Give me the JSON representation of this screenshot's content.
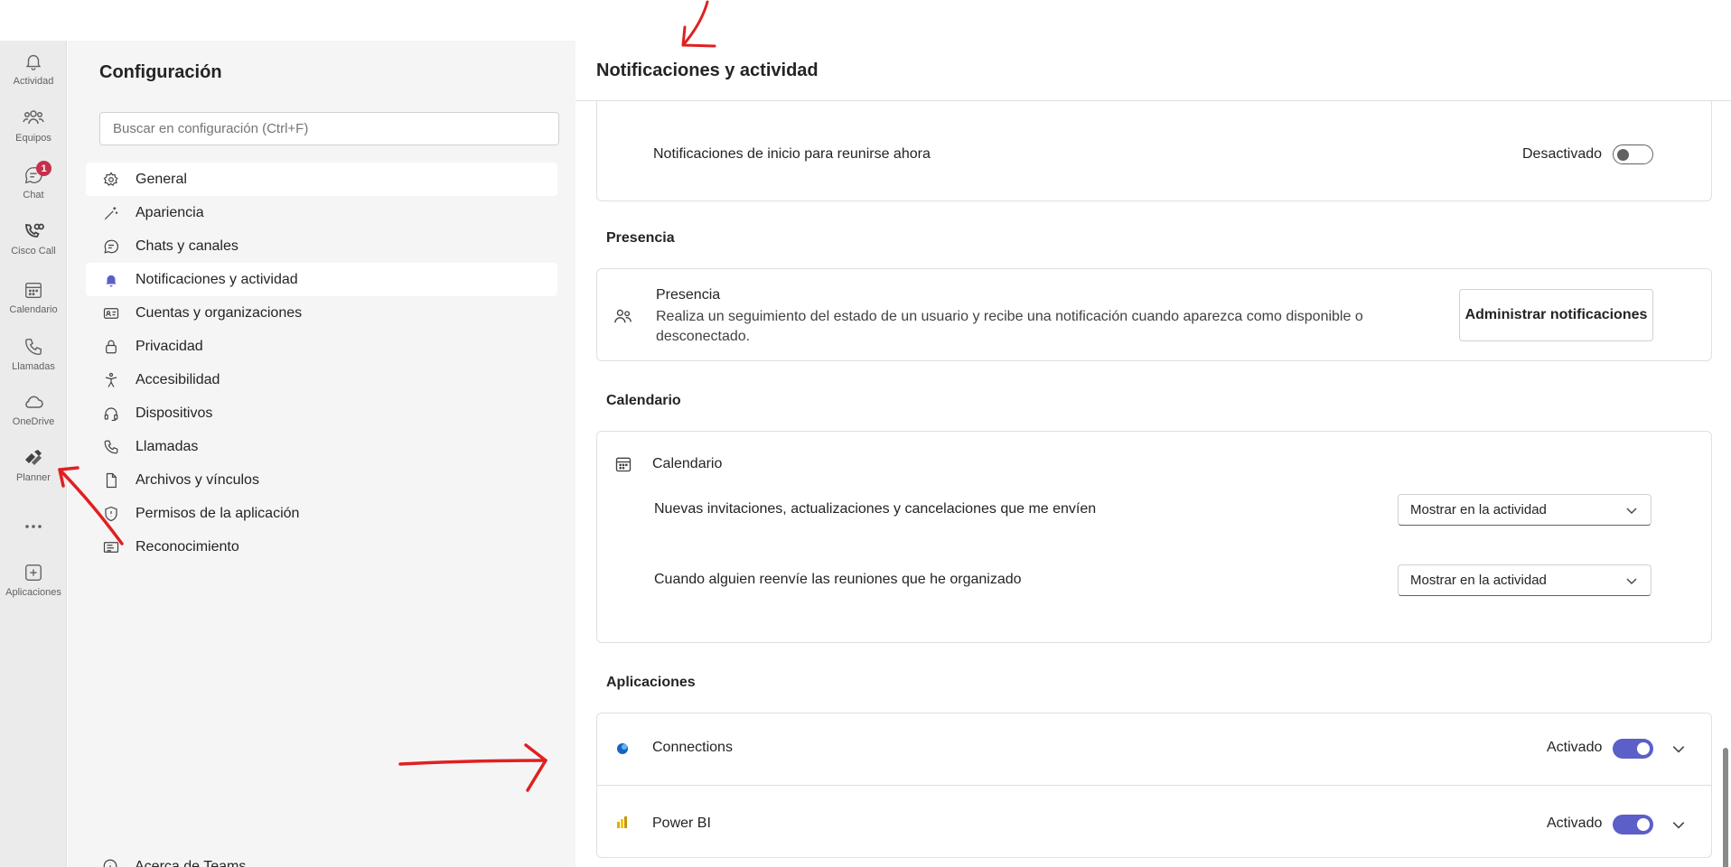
{
  "rail": {
    "items": [
      {
        "label": "Actividad",
        "icon": "bell-icon"
      },
      {
        "label": "Equipos",
        "icon": "teams-icon"
      },
      {
        "label": "Chat",
        "icon": "chat-icon",
        "badge": "1"
      },
      {
        "label": "Cisco Call",
        "icon": "cisco-call-icon"
      },
      {
        "label": "Calendario",
        "icon": "calendar-icon"
      },
      {
        "label": "Llamadas",
        "icon": "phone-icon"
      },
      {
        "label": "OneDrive",
        "icon": "cloud-icon"
      },
      {
        "label": "Planner",
        "icon": "planner-icon"
      },
      {
        "label": "",
        "icon": "more-icon"
      },
      {
        "label": "Aplicaciones",
        "icon": "add-app-icon"
      }
    ]
  },
  "settings_nav": {
    "title": "Configuración",
    "search_placeholder": "Buscar en configuración (Ctrl+F)",
    "items": [
      {
        "label": "General",
        "icon": "gear-icon"
      },
      {
        "label": "Apariencia",
        "icon": "wand-icon"
      },
      {
        "label": "Chats y canales",
        "icon": "chat-bubble-icon"
      },
      {
        "label": "Notificaciones y actividad",
        "icon": "bell-filled-icon"
      },
      {
        "label": "Cuentas y organizaciones",
        "icon": "contact-card-icon"
      },
      {
        "label": "Privacidad",
        "icon": "lock-icon"
      },
      {
        "label": "Accesibilidad",
        "icon": "accessibility-icon"
      },
      {
        "label": "Dispositivos",
        "icon": "headset-icon"
      },
      {
        "label": "Llamadas",
        "icon": "phone-icon"
      },
      {
        "label": "Archivos y vínculos",
        "icon": "document-icon"
      },
      {
        "label": "Permisos de la aplicación",
        "icon": "shield-icon"
      },
      {
        "label": "Reconocimiento",
        "icon": "recognition-icon"
      }
    ],
    "about": "Acerca de Teams"
  },
  "main": {
    "title": "Notificaciones y actividad",
    "meeting_start": {
      "label": "Notificaciones de inicio para reunirse ahora",
      "state": "Desactivado"
    },
    "presence_section": {
      "title": "Presencia",
      "item_title": "Presencia",
      "description": "Realiza un seguimiento del estado de un usuario y recibe una notificación cuando aparezca como disponible o desconectado.",
      "button_label": "Administrar notificaciones"
    },
    "calendar_section": {
      "title": "Calendario",
      "item_title": "Calendario",
      "rows": [
        {
          "label": "Nuevas invitaciones, actualizaciones y cancelaciones que me envíen",
          "value": "Mostrar en la actividad"
        },
        {
          "label": "Cuando alguien reenvíe las reuniones que he organizado",
          "value": "Mostrar en la actividad"
        }
      ]
    },
    "apps_section": {
      "title": "Aplicaciones",
      "apps": [
        {
          "name": "Connections",
          "state": "Activado"
        },
        {
          "name": "Power BI",
          "state": "Activado"
        }
      ]
    }
  },
  "colors": {
    "accent": "#5b5fc7",
    "badge": "#c4314b",
    "annotation": "#e02020"
  }
}
